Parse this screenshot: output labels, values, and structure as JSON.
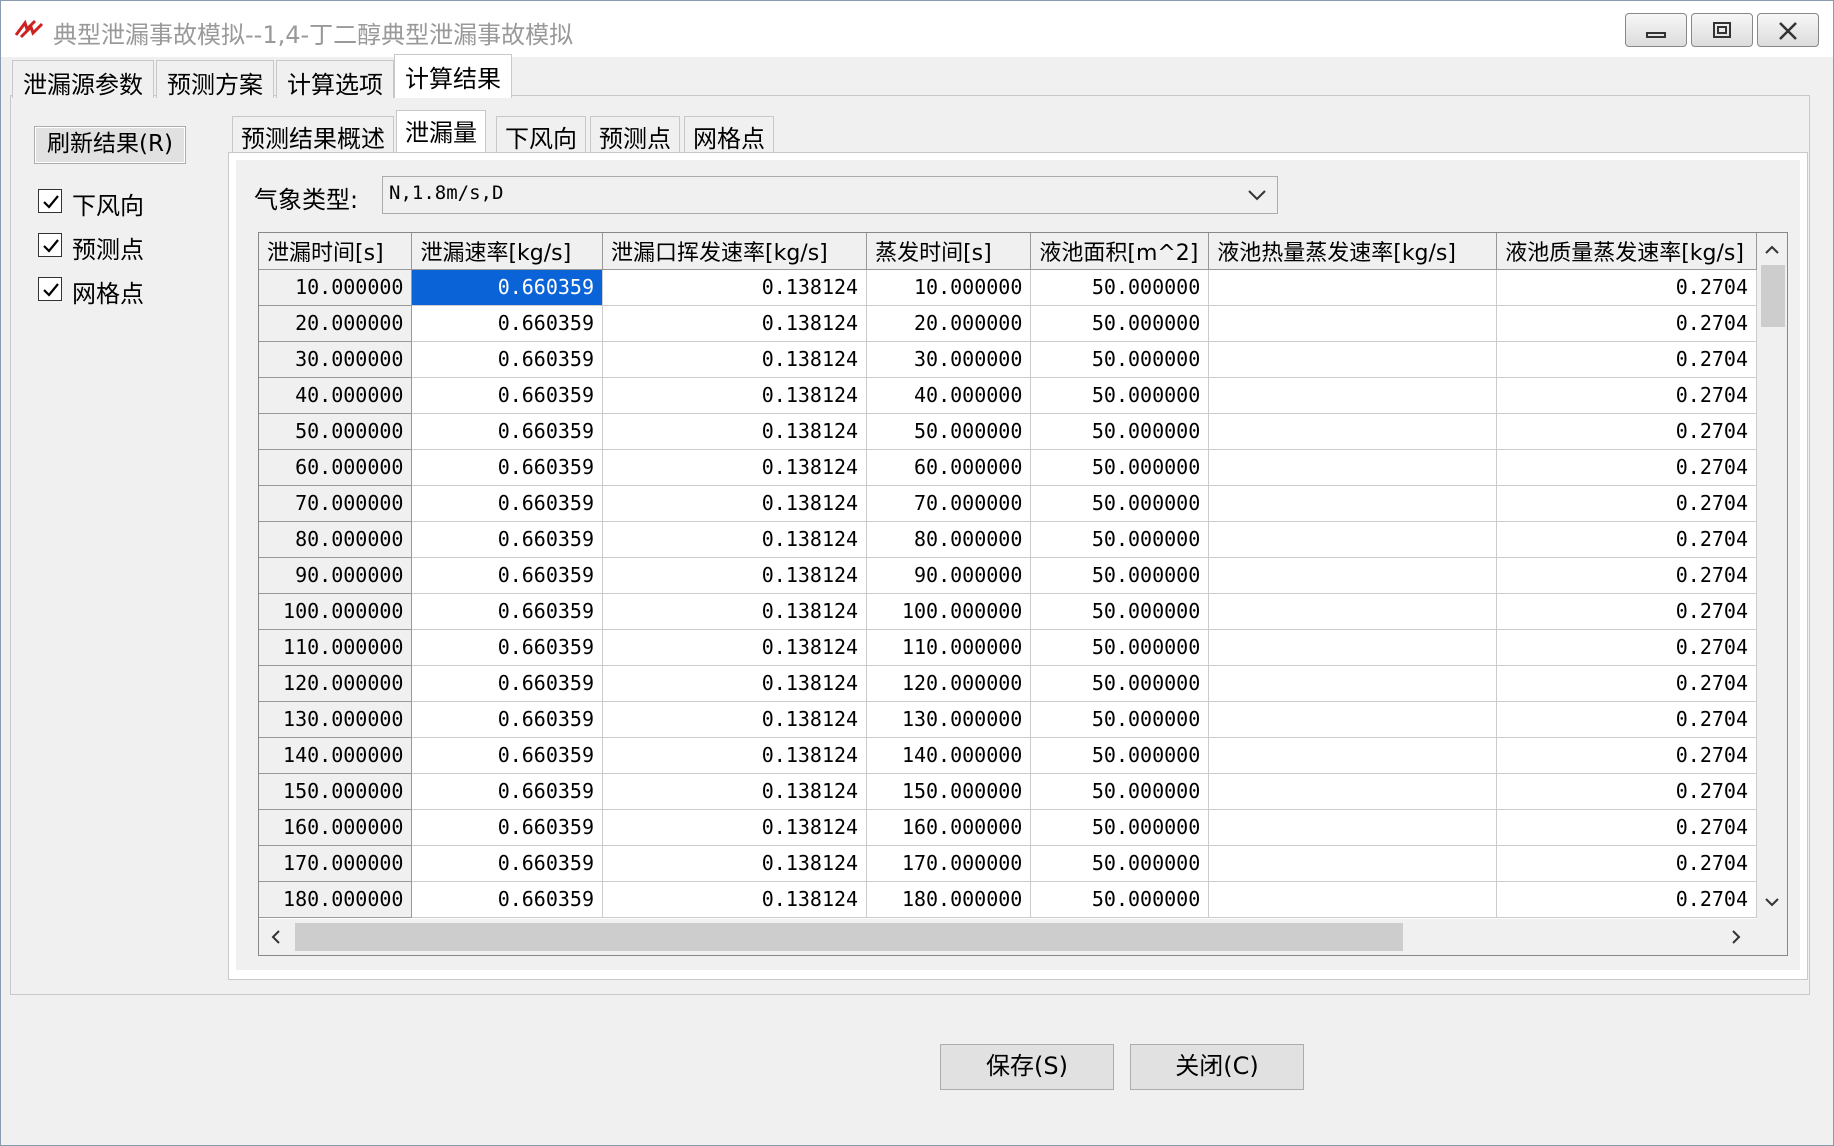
{
  "window": {
    "title": "典型泄漏事故模拟--1,4-丁二醇典型泄漏事故模拟"
  },
  "main_tabs": [
    "泄漏源参数",
    "预测方案",
    "计算选项",
    "计算结果"
  ],
  "left": {
    "refresh_label": "刷新结果(R)",
    "checks": [
      {
        "label": "下风向",
        "checked": true
      },
      {
        "label": "预测点",
        "checked": true
      },
      {
        "label": "网格点",
        "checked": true
      }
    ]
  },
  "sub_tabs": [
    "预测结果概述",
    "泄漏量",
    "下风向",
    "预测点",
    "网格点"
  ],
  "weather": {
    "label": "气象类型:",
    "value": "N,1.8m/s,D"
  },
  "table": {
    "headers": [
      "泄漏时间[s]",
      "泄漏速率[kg/s]",
      "泄漏口挥发速率[kg/s]",
      "蒸发时间[s]",
      "液池面积[m^2]",
      "液池热量蒸发速率[kg/s]",
      "液池质量蒸发速率[kg/s]"
    ],
    "rows": [
      [
        "10.000000",
        "0.660359",
        "0.138124",
        "10.000000",
        "50.000000",
        "",
        "0.2704"
      ],
      [
        "20.000000",
        "0.660359",
        "0.138124",
        "20.000000",
        "50.000000",
        "",
        "0.2704"
      ],
      [
        "30.000000",
        "0.660359",
        "0.138124",
        "30.000000",
        "50.000000",
        "",
        "0.2704"
      ],
      [
        "40.000000",
        "0.660359",
        "0.138124",
        "40.000000",
        "50.000000",
        "",
        "0.2704"
      ],
      [
        "50.000000",
        "0.660359",
        "0.138124",
        "50.000000",
        "50.000000",
        "",
        "0.2704"
      ],
      [
        "60.000000",
        "0.660359",
        "0.138124",
        "60.000000",
        "50.000000",
        "",
        "0.2704"
      ],
      [
        "70.000000",
        "0.660359",
        "0.138124",
        "70.000000",
        "50.000000",
        "",
        "0.2704"
      ],
      [
        "80.000000",
        "0.660359",
        "0.138124",
        "80.000000",
        "50.000000",
        "",
        "0.2704"
      ],
      [
        "90.000000",
        "0.660359",
        "0.138124",
        "90.000000",
        "50.000000",
        "",
        "0.2704"
      ],
      [
        "100.000000",
        "0.660359",
        "0.138124",
        "100.000000",
        "50.000000",
        "",
        "0.2704"
      ],
      [
        "110.000000",
        "0.660359",
        "0.138124",
        "110.000000",
        "50.000000",
        "",
        "0.2704"
      ],
      [
        "120.000000",
        "0.660359",
        "0.138124",
        "120.000000",
        "50.000000",
        "",
        "0.2704"
      ],
      [
        "130.000000",
        "0.660359",
        "0.138124",
        "130.000000",
        "50.000000",
        "",
        "0.2704"
      ],
      [
        "140.000000",
        "0.660359",
        "0.138124",
        "140.000000",
        "50.000000",
        "",
        "0.2704"
      ],
      [
        "150.000000",
        "0.660359",
        "0.138124",
        "150.000000",
        "50.000000",
        "",
        "0.2704"
      ],
      [
        "160.000000",
        "0.660359",
        "0.138124",
        "160.000000",
        "50.000000",
        "",
        "0.2704"
      ],
      [
        "170.000000",
        "0.660359",
        "0.138124",
        "170.000000",
        "50.000000",
        "",
        "0.2704"
      ],
      [
        "180.000000",
        "0.660359",
        "0.138124",
        "180.000000",
        "50.000000",
        "",
        "0.2704"
      ]
    ]
  },
  "buttons": {
    "save": "保存(S)",
    "close": "关闭(C)"
  },
  "colors": {
    "selection": "#0a64d8"
  }
}
